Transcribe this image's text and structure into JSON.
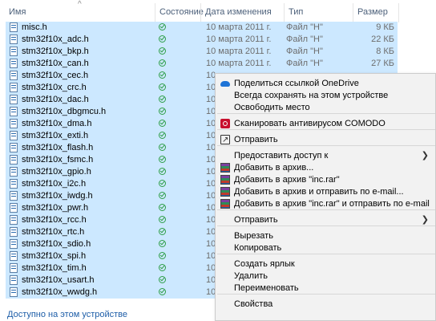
{
  "columns": {
    "name": "Имя",
    "status": "Состояние",
    "date": "Дата изменения",
    "type": "Тип",
    "size": "Размер"
  },
  "files": [
    {
      "name": "misc.h",
      "date": "10 марта 2011 г.",
      "type": "Файл \"H\"",
      "size": "9 КБ"
    },
    {
      "name": "stm32f10x_adc.h",
      "date": "10 марта 2011 г.",
      "type": "Файл \"H\"",
      "size": "22 КБ"
    },
    {
      "name": "stm32f10x_bkp.h",
      "date": "10 марта 2011 г.",
      "type": "Файл \"H\"",
      "size": "8 КБ"
    },
    {
      "name": "stm32f10x_can.h",
      "date": "10 марта 2011 г.",
      "type": "Файл \"H\"",
      "size": "27 КБ"
    },
    {
      "name": "stm32f10x_cec.h",
      "date": "10",
      "type": "",
      "size": ""
    },
    {
      "name": "stm32f10x_crc.h",
      "date": "10",
      "type": "",
      "size": ""
    },
    {
      "name": "stm32f10x_dac.h",
      "date": "10",
      "type": "",
      "size": ""
    },
    {
      "name": "stm32f10x_dbgmcu.h",
      "date": "10",
      "type": "",
      "size": ""
    },
    {
      "name": "stm32f10x_dma.h",
      "date": "10",
      "type": "",
      "size": ""
    },
    {
      "name": "stm32f10x_exti.h",
      "date": "10",
      "type": "",
      "size": ""
    },
    {
      "name": "stm32f10x_flash.h",
      "date": "10",
      "type": "",
      "size": ""
    },
    {
      "name": "stm32f10x_fsmc.h",
      "date": "10",
      "type": "",
      "size": ""
    },
    {
      "name": "stm32f10x_gpio.h",
      "date": "10",
      "type": "",
      "size": ""
    },
    {
      "name": "stm32f10x_i2c.h",
      "date": "10",
      "type": "",
      "size": ""
    },
    {
      "name": "stm32f10x_iwdg.h",
      "date": "10",
      "type": "",
      "size": ""
    },
    {
      "name": "stm32f10x_pwr.h",
      "date": "10",
      "type": "",
      "size": ""
    },
    {
      "name": "stm32f10x_rcc.h",
      "date": "10",
      "type": "",
      "size": ""
    },
    {
      "name": "stm32f10x_rtc.h",
      "date": "10",
      "type": "",
      "size": ""
    },
    {
      "name": "stm32f10x_sdio.h",
      "date": "10",
      "type": "",
      "size": ""
    },
    {
      "name": "stm32f10x_spi.h",
      "date": "10",
      "type": "",
      "size": ""
    },
    {
      "name": "stm32f10x_tim.h",
      "date": "10",
      "type": "",
      "size": ""
    },
    {
      "name": "stm32f10x_usart.h",
      "date": "10",
      "type": "",
      "size": ""
    },
    {
      "name": "stm32f10x_wwdg.h",
      "date": "10",
      "type": "",
      "size": ""
    }
  ],
  "status_bar": "Доступно на этом устройстве",
  "context_menu": [
    {
      "label": "Поделиться ссылкой OneDrive",
      "icon": "onedrive-icon"
    },
    {
      "label": "Всегда сохранять на этом устройстве",
      "icon": ""
    },
    {
      "label": "Освободить место",
      "icon": ""
    },
    {
      "separator": true
    },
    {
      "label": "Сканировать антивирусом COMODO",
      "icon": "comodo-icon"
    },
    {
      "separator": true
    },
    {
      "label": "Отправить",
      "icon": "share-icon"
    },
    {
      "separator": true
    },
    {
      "label": "Предоставить доступ к",
      "icon": "",
      "submenu": true
    },
    {
      "label": "Добавить в архив...",
      "icon": "winrar-icon"
    },
    {
      "label": "Добавить в архив \"inc.rar\"",
      "icon": "winrar-icon"
    },
    {
      "label": "Добавить в архив и отправить по e-mail...",
      "icon": "winrar-icon"
    },
    {
      "label": "Добавить в архив \"inc.rar\" и отправить по e-mail",
      "icon": "winrar-icon"
    },
    {
      "separator": true
    },
    {
      "label": "Отправить",
      "icon": "",
      "submenu": true
    },
    {
      "separator": true
    },
    {
      "label": "Вырезать",
      "icon": ""
    },
    {
      "label": "Копировать",
      "icon": ""
    },
    {
      "separator": true
    },
    {
      "label": "Создать ярлык",
      "icon": ""
    },
    {
      "label": "Удалить",
      "icon": ""
    },
    {
      "label": "Переименовать",
      "icon": ""
    },
    {
      "separator": true
    },
    {
      "label": "Свойства",
      "icon": ""
    }
  ]
}
